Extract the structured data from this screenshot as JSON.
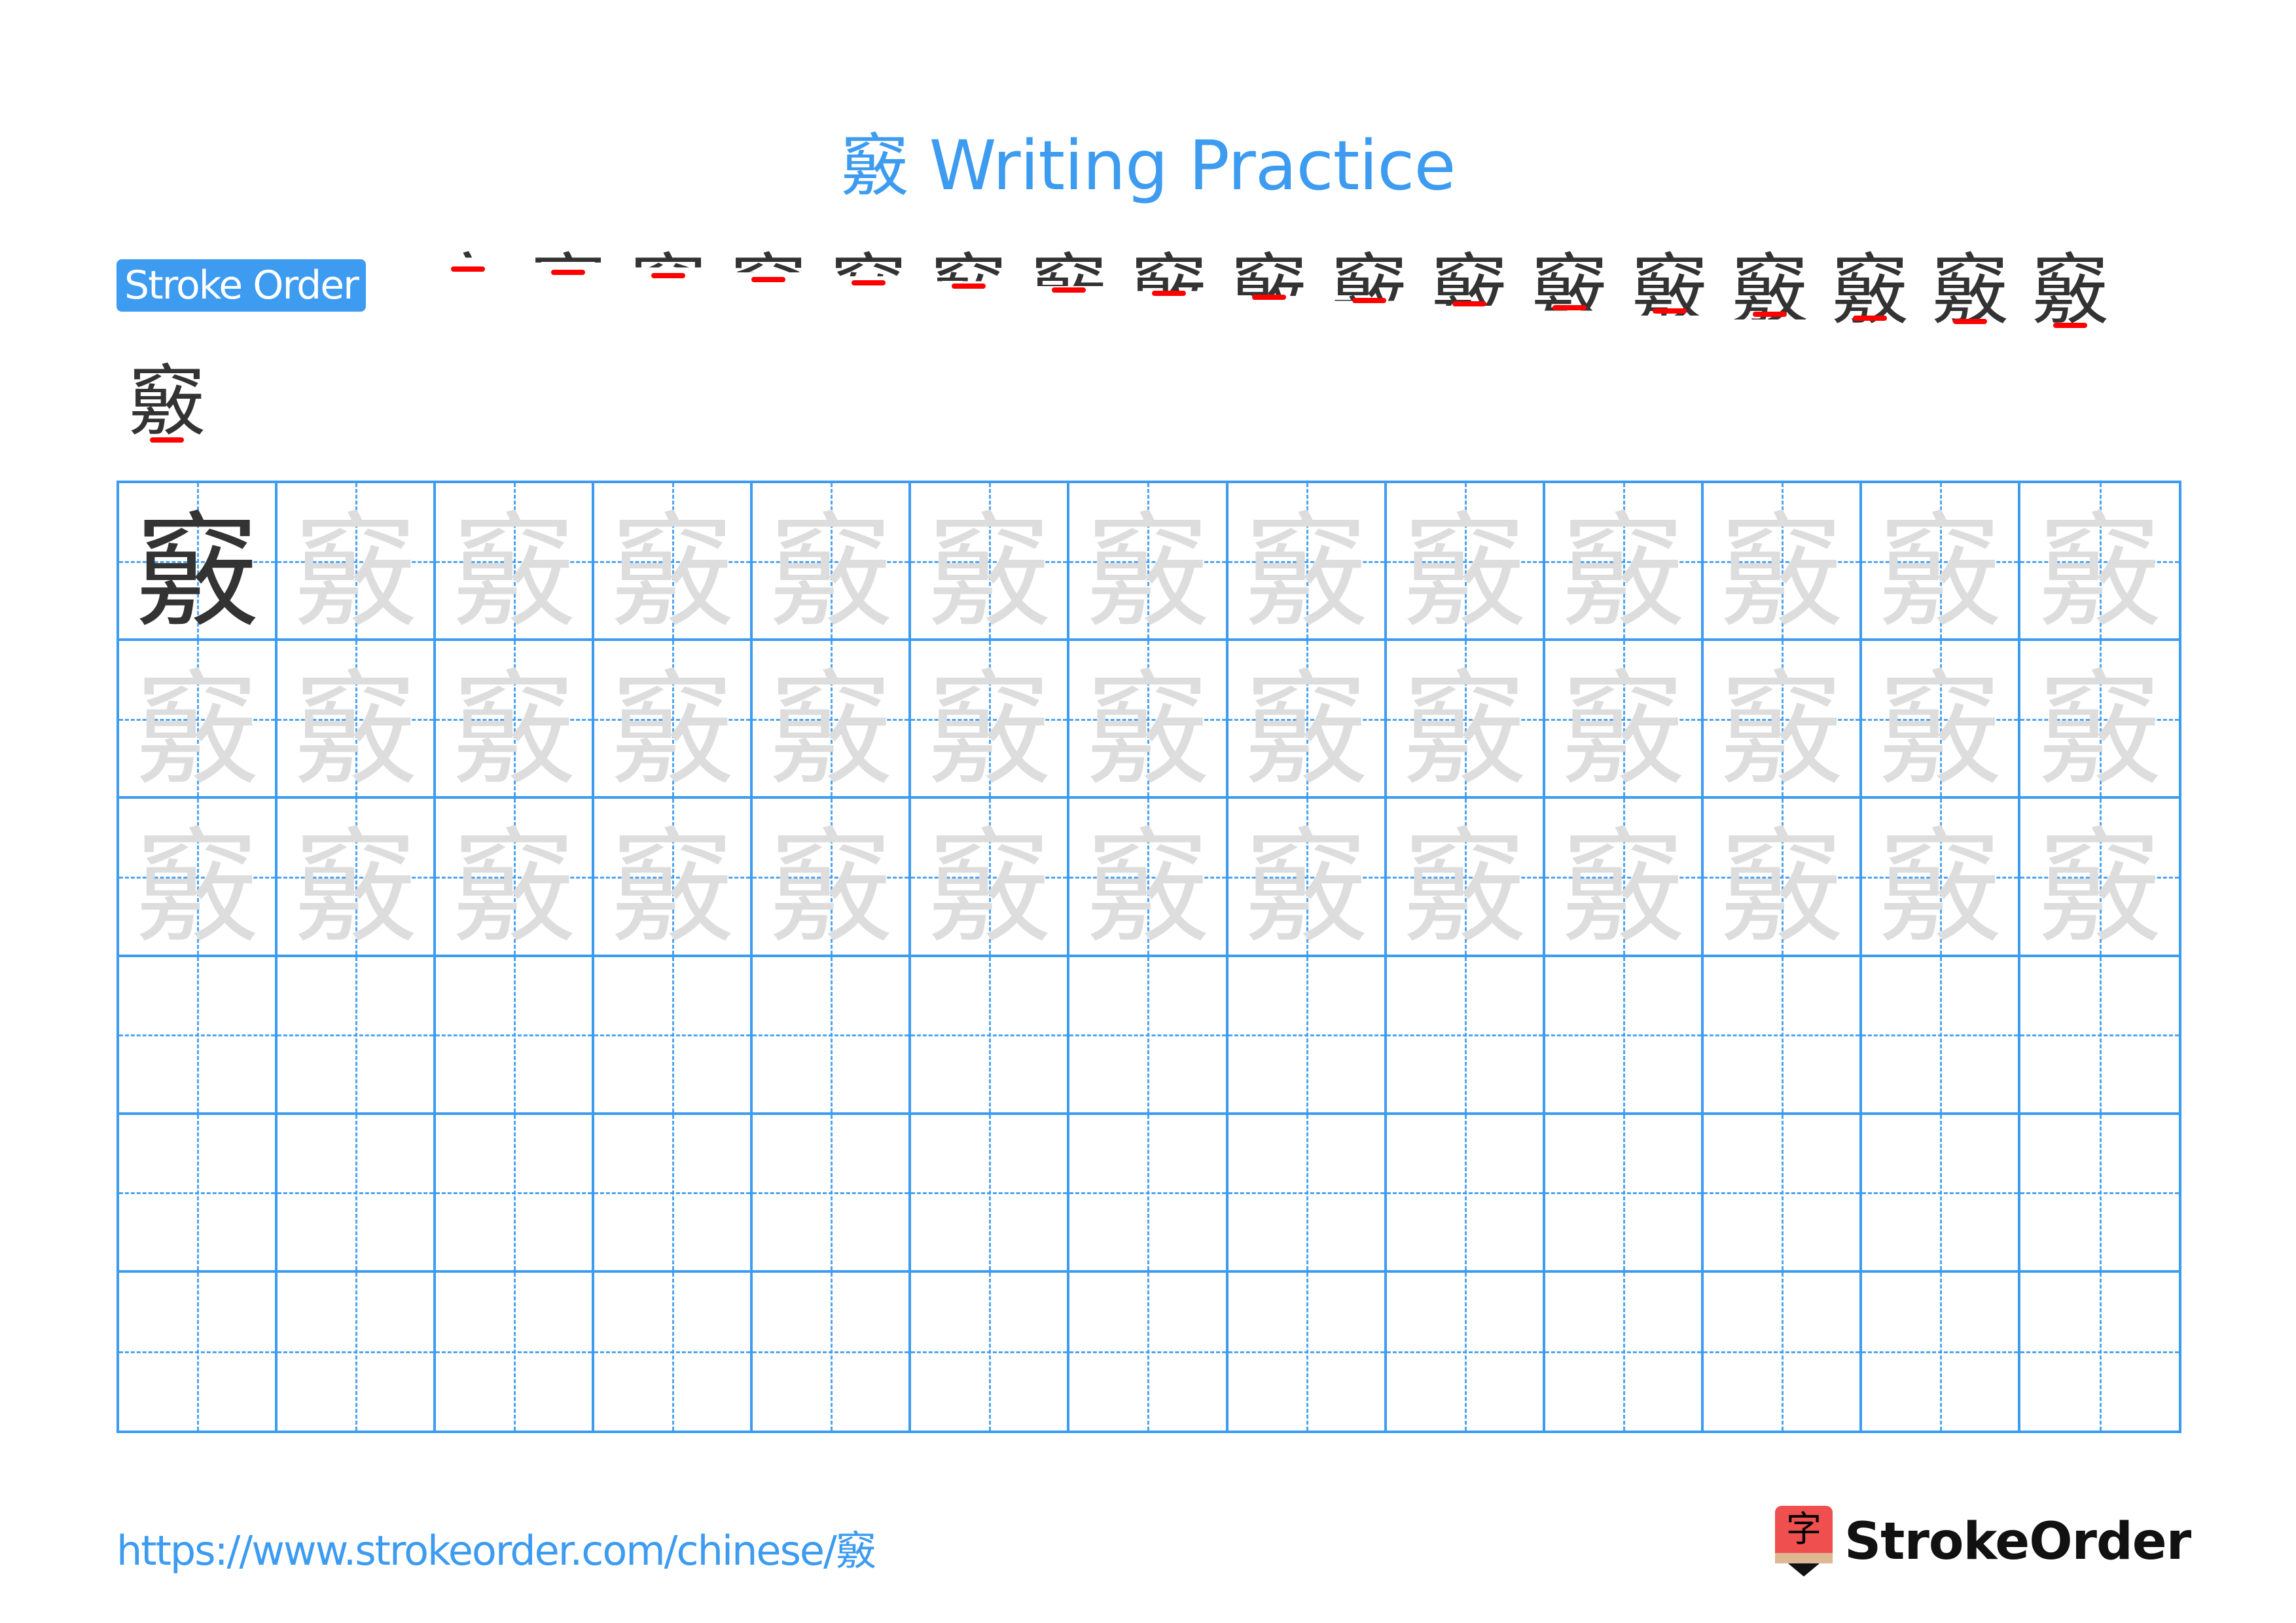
{
  "character": "竅",
  "title": "竅 Writing Practice",
  "stroke_order": {
    "label": "Stroke Order",
    "total_strokes": 18,
    "frames_per_first_row": 17,
    "current_stroke_color": "#ff0000",
    "previous_stroke_color": "#333333"
  },
  "grid": {
    "rows": 6,
    "cols": 13,
    "model_cells": 1,
    "trace_rows": 3,
    "empty_rows": 3,
    "line_color": "#3d9bf0",
    "model_color": "#333333",
    "trace_color": "#dddddd"
  },
  "footer": {
    "url": "https://www.strokeorder.com/chinese/竅",
    "brand_name": "StrokeOrder",
    "brand_logo_glyph": "字",
    "accent_color": "#3d9bf0",
    "logo_color": "#f04f4f"
  }
}
